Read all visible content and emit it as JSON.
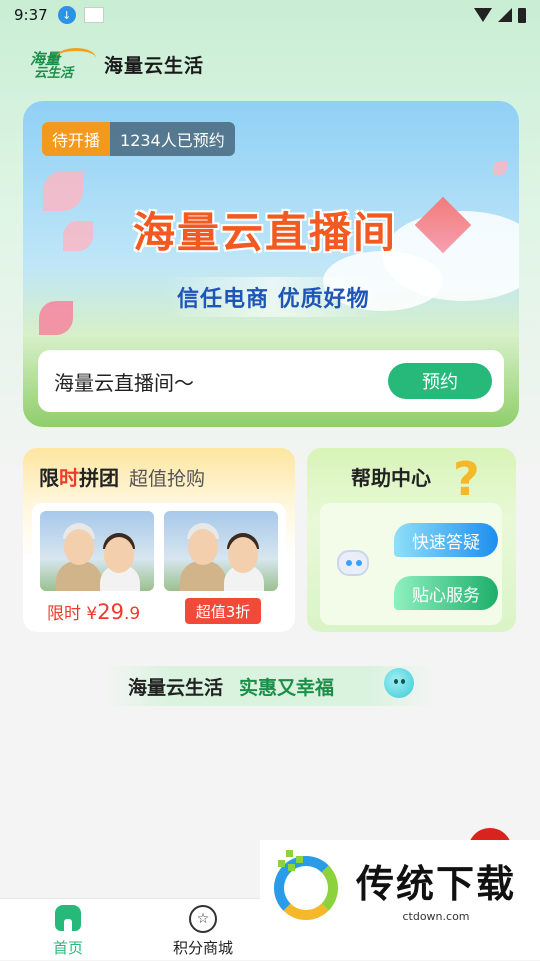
{
  "status_bar": {
    "time": "9:37"
  },
  "header": {
    "app_title": "海量云生活",
    "logo_text_1": "海量",
    "logo_text_2": "云生活"
  },
  "banner": {
    "status_badge": "待开播",
    "reservations": "1234人已预约",
    "title": "海量云直播间",
    "subtitle": "信任电商  优质好物",
    "room_name": "海量云直播间～",
    "reserve_label": "预约"
  },
  "group_buy": {
    "title_1": "限",
    "title_2": "时",
    "title_3": "拼团",
    "subtitle": "超值抢购",
    "price_prefix": "限时 ¥",
    "price_int": "29",
    "price_dec": ".9",
    "discount": "超值3折"
  },
  "help_center": {
    "title": "帮助中心",
    "qmark": "?",
    "quick_answer": "快速答疑",
    "service": "贴心服务"
  },
  "slogan": {
    "left": "海量云生活",
    "right": "实惠又幸福"
  },
  "tabbar": {
    "tabs": [
      {
        "label": "首页",
        "icon": "home-icon",
        "active": true
      },
      {
        "label": "积分商城",
        "icon": "points-mall-icon",
        "active": false
      }
    ]
  },
  "watermark": {
    "brand": "传统下载",
    "url": "ctdown.com"
  },
  "colors": {
    "accent_green": "#27b97a",
    "price_red": "#f03a2e",
    "badge_orange": "#f39a1e"
  }
}
